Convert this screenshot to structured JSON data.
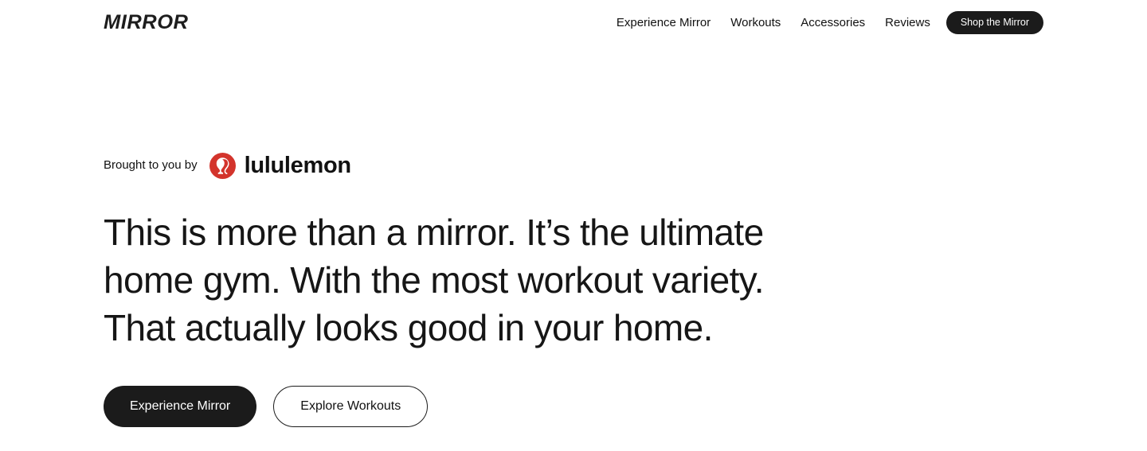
{
  "header": {
    "logo_text": "MIRROR",
    "logo_icon": "mirror-wordmark",
    "nav": [
      {
        "label": "Experience Mirror"
      },
      {
        "label": "Workouts"
      },
      {
        "label": "Accessories"
      },
      {
        "label": "Reviews"
      }
    ],
    "shop_button_label": "Shop the Mirror"
  },
  "hero": {
    "brought_to_you_by": "Brought to you by",
    "partner": {
      "name": "lululemon",
      "logo_icon": "lululemon-omega-icon",
      "logo_color": "#d3342c"
    },
    "headline": "This is more than a mirror. It’s the ultimate home gym. With the most workout variety. That actually looks good in your home.",
    "primary_cta": "Experience Mirror",
    "secondary_cta": "Explore Workouts"
  },
  "colors": {
    "background": "#ffffff",
    "text": "#111111",
    "dark_fill": "#1b1b1b",
    "accent_red": "#d3342c"
  }
}
